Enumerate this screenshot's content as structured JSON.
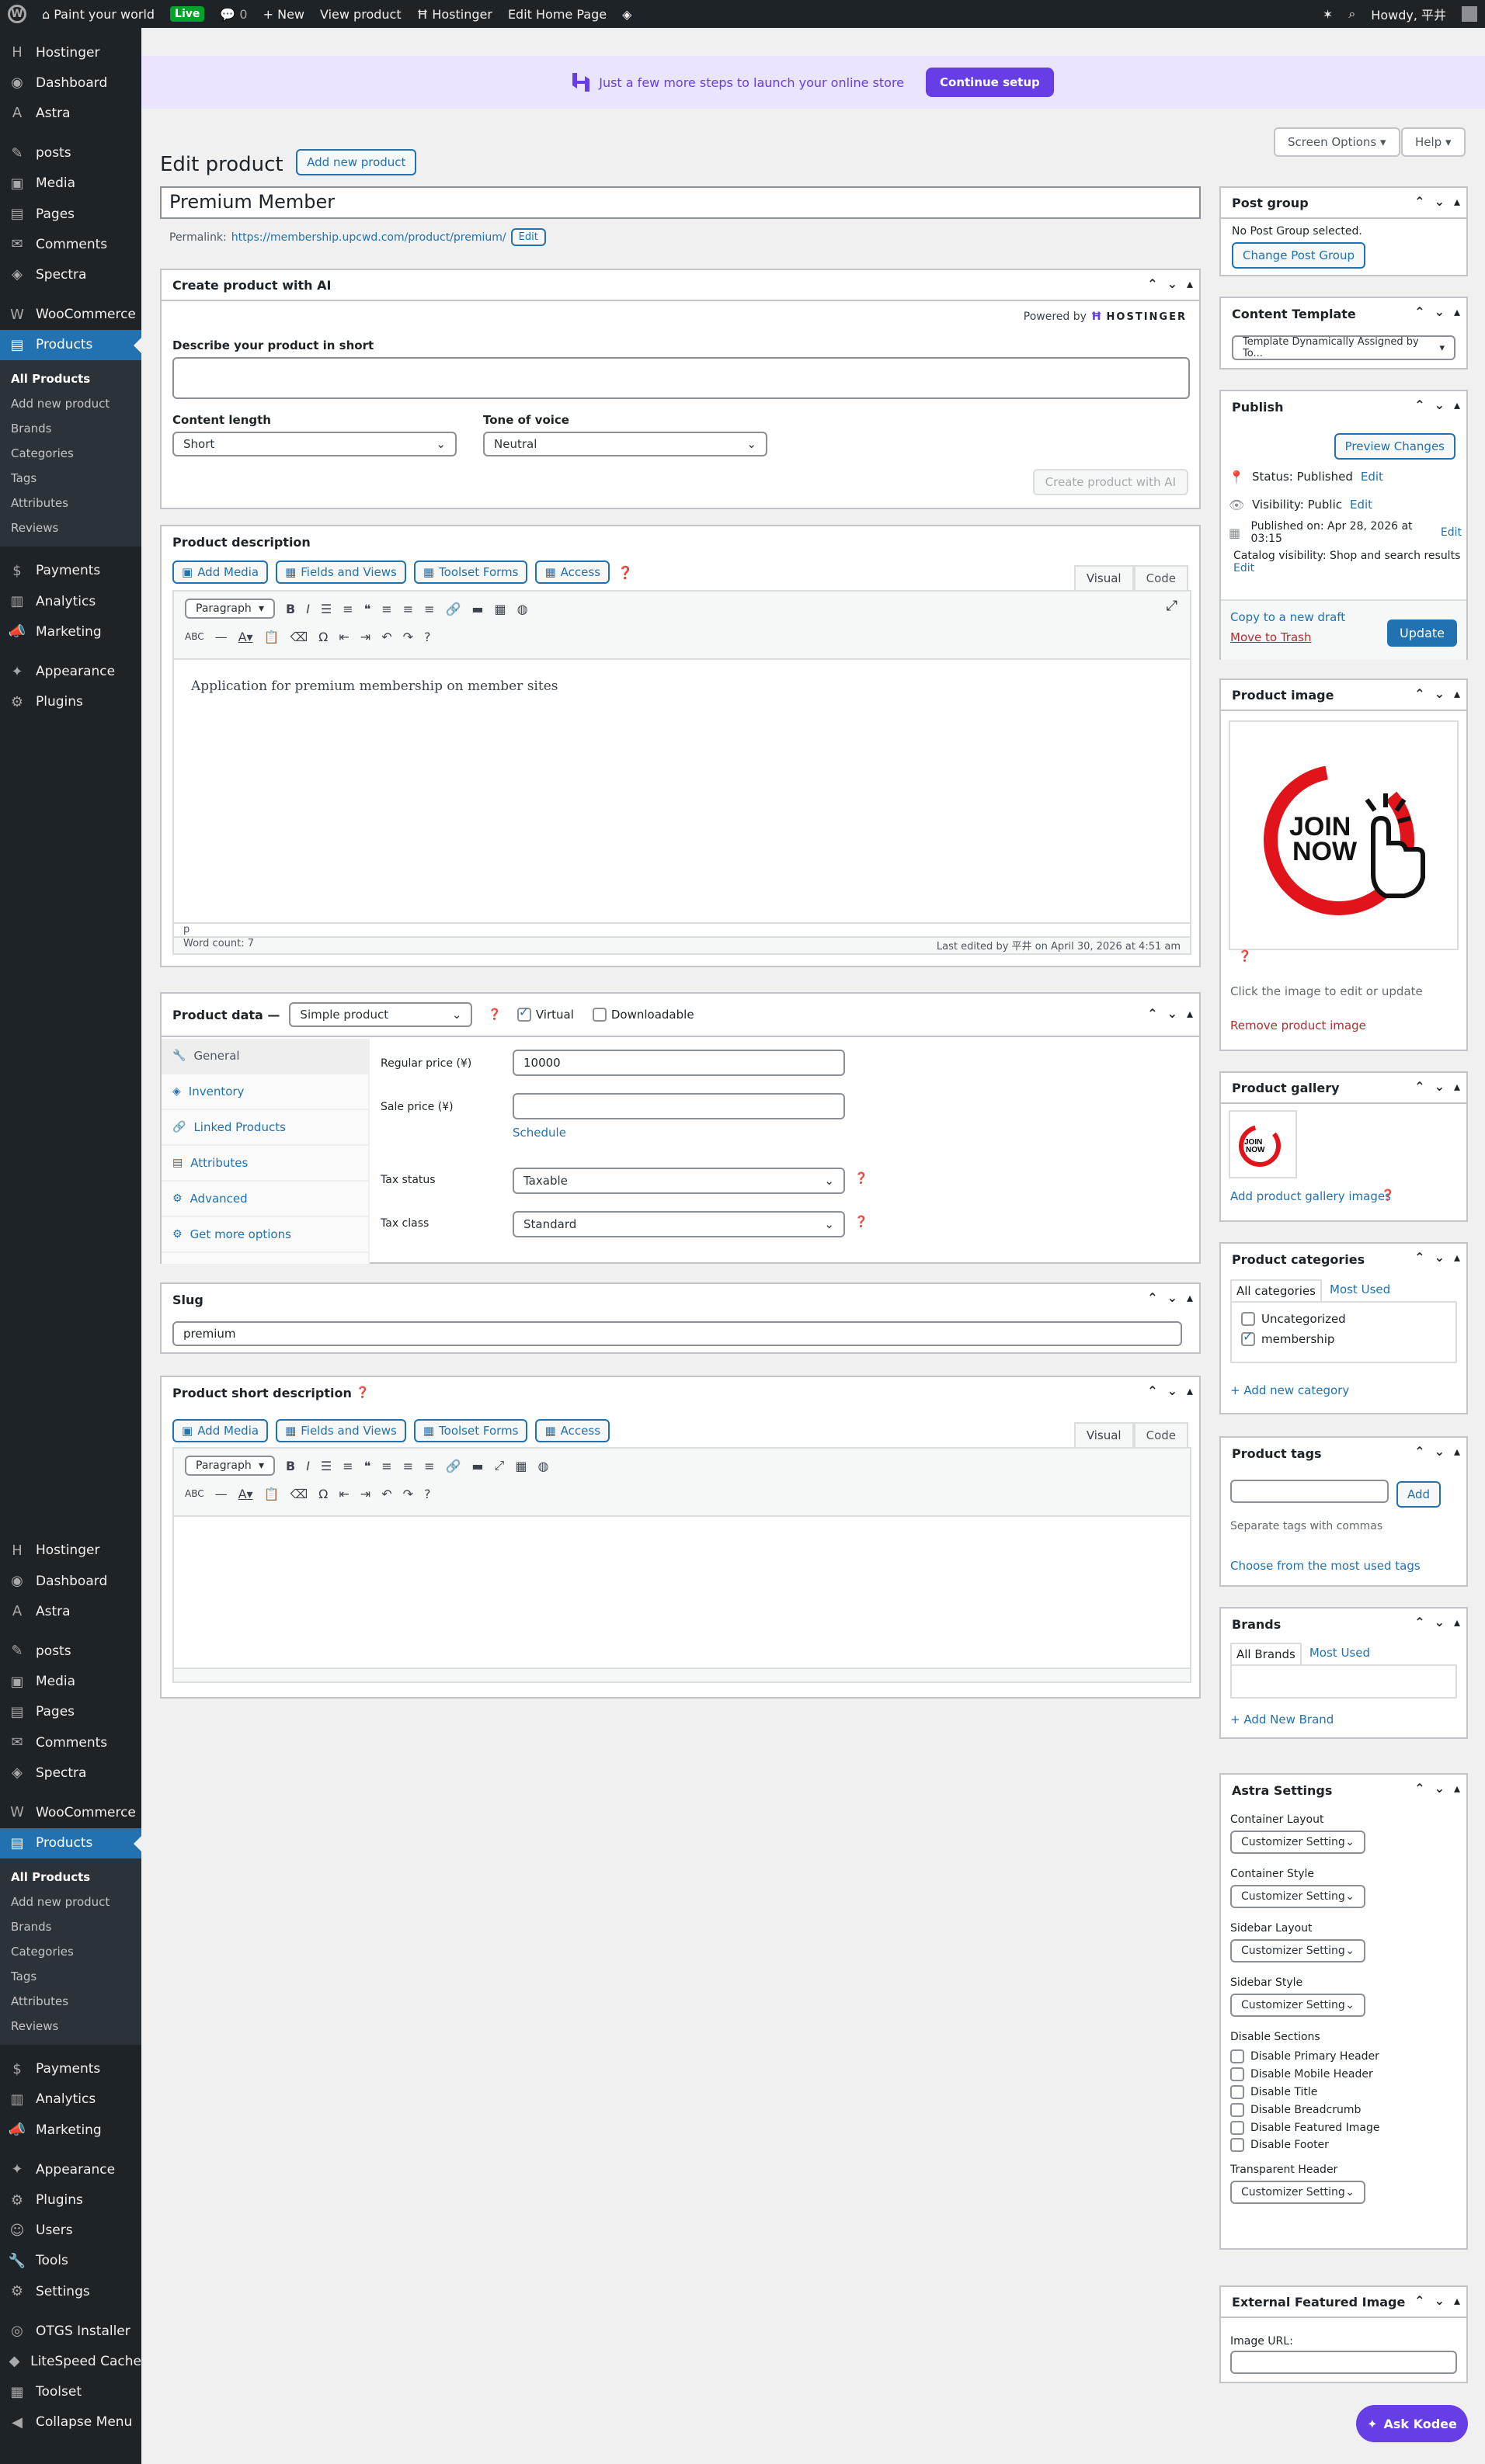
{
  "adminbar": {
    "site": "Paint your world",
    "live": "Live",
    "comments": "0",
    "new": "New",
    "view": "View product",
    "hostinger": "Hostinger",
    "edit_home": "Edit Home Page",
    "howdy": "Howdy, 平井"
  },
  "sidebar": {
    "top": [
      {
        "label": "Hostinger",
        "icon": "H"
      },
      {
        "label": "Dashboard",
        "icon": "◉"
      },
      {
        "label": "Astra",
        "icon": "A"
      }
    ],
    "mid": [
      {
        "label": "posts",
        "icon": "✎"
      },
      {
        "label": "Media",
        "icon": "▣"
      },
      {
        "label": "Pages",
        "icon": "▤"
      },
      {
        "label": "Comments",
        "icon": "✉"
      },
      {
        "label": "Spectra",
        "icon": "◈"
      }
    ],
    "woo": "WooCommerce",
    "products": "Products",
    "sub": [
      "All Products",
      "Add new product",
      "Brands",
      "Categories",
      "Tags",
      "Attributes",
      "Reviews"
    ],
    "bottom1": [
      {
        "label": "Payments",
        "icon": "$"
      },
      {
        "label": "Analytics",
        "icon": "▥"
      },
      {
        "label": "Marketing",
        "icon": "📣"
      }
    ],
    "bottom2": [
      {
        "label": "Appearance",
        "icon": "✦"
      },
      {
        "label": "Plugins",
        "icon": "⚙"
      }
    ],
    "repeat_extra": [
      {
        "label": "Users",
        "icon": "☺"
      },
      {
        "label": "Tools",
        "icon": "🔧"
      },
      {
        "label": "Settings",
        "icon": "⚙"
      }
    ],
    "repeat_extra2": [
      {
        "label": "OTGS Installer",
        "icon": "◎"
      },
      {
        "label": "LiteSpeed Cache",
        "icon": "◆"
      },
      {
        "label": "Toolset",
        "icon": "▦"
      },
      {
        "label": "Collapse Menu",
        "icon": "◀"
      }
    ]
  },
  "banner": {
    "text": "Just a few more steps to launch your online store",
    "button": "Continue setup"
  },
  "screen_options": "Screen Options ▾",
  "help": "Help ▾",
  "page_title": "Edit product",
  "add_new": "Add new product",
  "title_value": "Premium Member",
  "permalink": {
    "label": "Permalink:",
    "url": "https://membership.upcwd.com/product/premium/",
    "edit": "Edit"
  },
  "ai": {
    "heading": "Create product with AI",
    "powered": "Powered by",
    "brand": "HOSTINGER",
    "describe": "Describe your product in short",
    "length_label": "Content length",
    "length": "Short",
    "tone_label": "Tone of voice",
    "tone": "Neutral",
    "button": "Create product with AI"
  },
  "desc": {
    "heading": "Product description",
    "add_media": "Add Media",
    "fields": "Fields and Views",
    "forms": "Toolset Forms",
    "access": "Access",
    "visual": "Visual",
    "code": "Code",
    "paragraph": "Paragraph",
    "content": "Application for premium membership on member sites",
    "p": "p",
    "wordcount": "Word count: 7",
    "lastedit": "Last edited by 平井 on April 30, 2026 at 4:51 am"
  },
  "pdata": {
    "heading": "Product data —",
    "type": "Simple product",
    "virtual": "Virtual",
    "downloadable": "Downloadable",
    "tabs": [
      "General",
      "Inventory",
      "Linked Products",
      "Attributes",
      "Advanced",
      "Get more options"
    ],
    "regular_label": "Regular price (¥)",
    "regular": "10000",
    "sale_label": "Sale price (¥)",
    "schedule": "Schedule",
    "tax_status_label": "Tax status",
    "tax_status": "Taxable",
    "tax_class_label": "Tax class",
    "tax_class": "Standard"
  },
  "slug": {
    "heading": "Slug",
    "value": "premium"
  },
  "short": {
    "heading": "Product short description"
  },
  "postgroup": {
    "heading": "Post group",
    "text": "No Post Group selected.",
    "button": "Change Post Group"
  },
  "template": {
    "heading": "Content Template",
    "value": "Template Dynamically Assigned by To..."
  },
  "publish": {
    "heading": "Publish",
    "preview": "Preview Changes",
    "status": "Status: Published",
    "visibility": "Visibility: Public",
    "published": "Published on: Apr 28, 2026 at 03:15",
    "edit": "Edit",
    "catalog": "Catalog visibility: Shop and search results",
    "draft": "Copy to a new draft",
    "trash": "Move to Trash",
    "update": "Update"
  },
  "image": {
    "heading": "Product image",
    "join": "JOIN",
    "now": "NOW",
    "hint": "Click the image to edit or update",
    "remove": "Remove product image"
  },
  "gallery": {
    "heading": "Product gallery",
    "add": "Add product gallery images"
  },
  "cats": {
    "heading": "Product categories",
    "all": "All categories",
    "most": "Most Used",
    "items": [
      "Uncategorized",
      "membership"
    ],
    "add": "+ Add new category"
  },
  "tags": {
    "heading": "Product tags",
    "add": "Add",
    "sep": "Separate tags with commas",
    "choose": "Choose from the most used tags"
  },
  "brands": {
    "heading": "Brands",
    "all": "All Brands",
    "most": "Most Used",
    "add": "+ Add New Brand"
  },
  "astra": {
    "heading": "Astra Settings",
    "container_layout": "Container Layout",
    "container_style": "Container Style",
    "sidebar_layout": "Sidebar Layout",
    "sidebar_style": "Sidebar Style",
    "customizer": "Customizer Setting",
    "disable": "Disable Sections",
    "checks": [
      "Disable Primary Header",
      "Disable Mobile Header",
      "Disable Title",
      "Disable Breadcrumb",
      "Disable Featured Image",
      "Disable Footer"
    ],
    "transparent": "Transparent Header"
  },
  "external": {
    "heading": "External Featured Image",
    "url_label": "Image URL:"
  },
  "ask": "Ask Kodee"
}
